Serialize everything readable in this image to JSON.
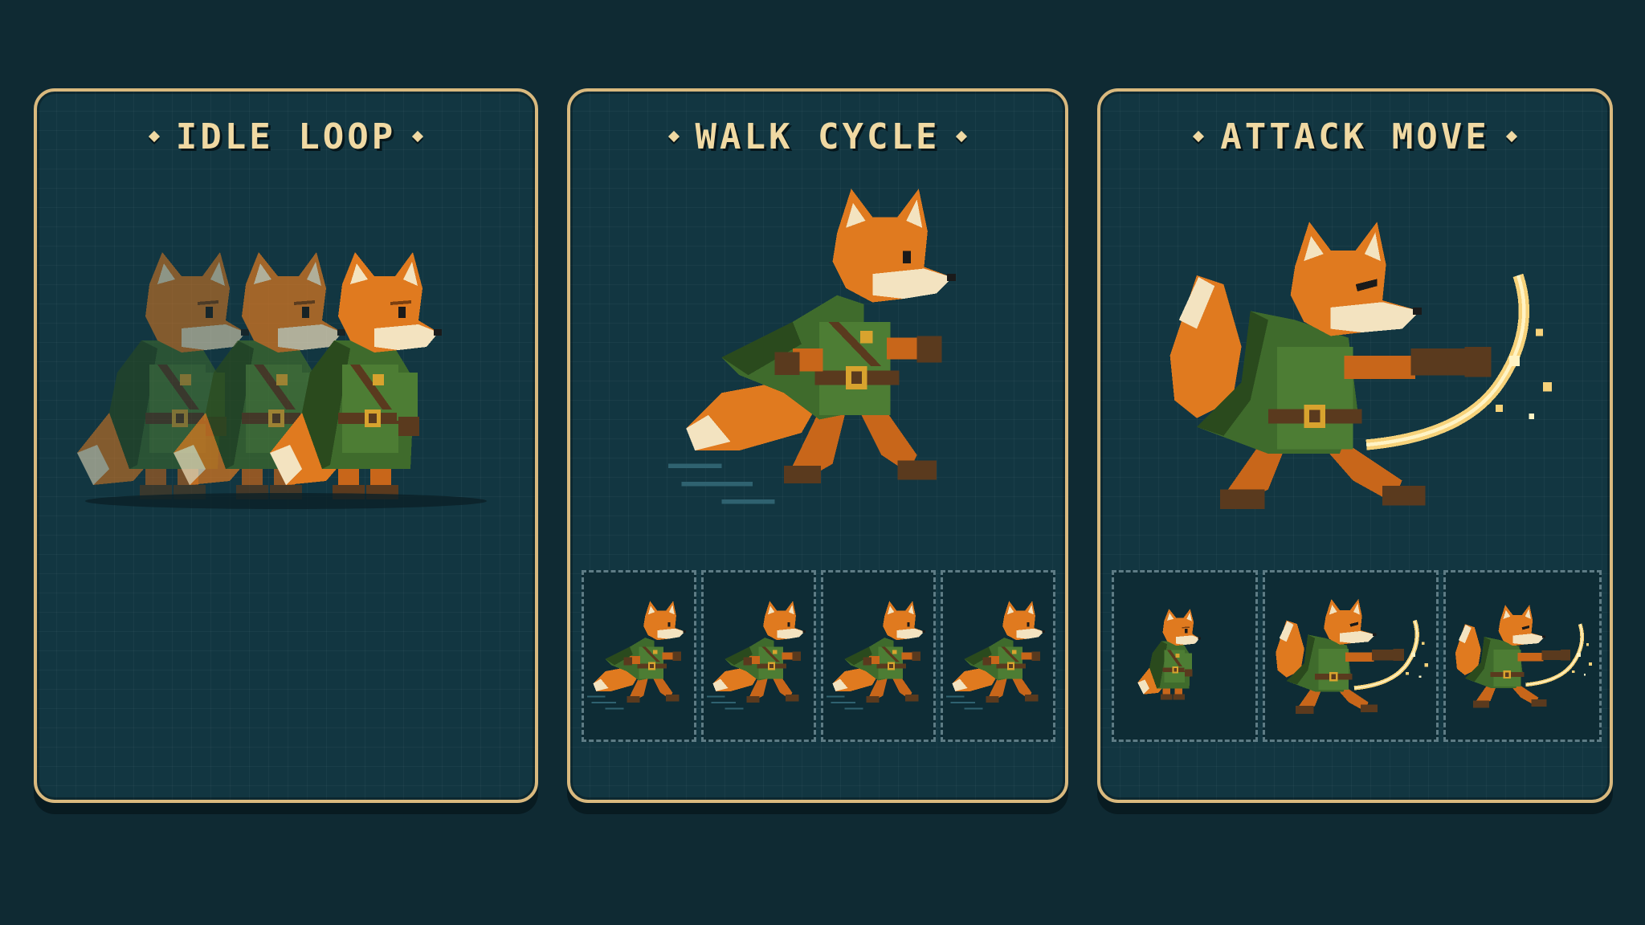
{
  "panels": {
    "idle": {
      "title": "IDLE LOOP"
    },
    "walk": {
      "title": "WALK CYCLE",
      "frame_count": 4
    },
    "attack": {
      "title": "ATTACK MOVE",
      "frame_count": 3
    }
  },
  "colors": {
    "background": "#0f2a33",
    "panel": "#123641",
    "border": "#d9b97e",
    "title": "#f0d9a3",
    "fur": "#e07a1f",
    "fur_dark": "#b85a12",
    "fur_light": "#f3e3c0",
    "cloak": "#3f6b2c",
    "cloak_dark": "#2a4a1d",
    "belt": "#5a3a1e",
    "buckle": "#d8a32e",
    "slash": "#f7d27a"
  }
}
